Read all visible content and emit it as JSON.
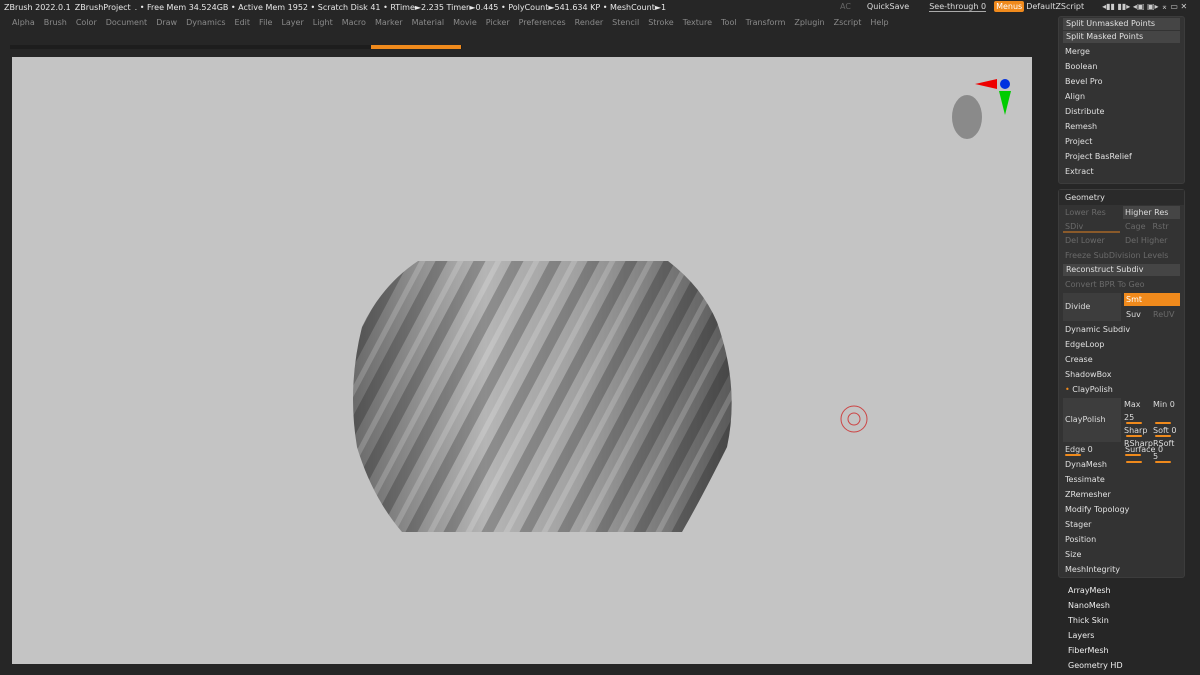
{
  "title": {
    "app": "ZBrush 2022.0.1",
    "project": "ZBrushProject",
    "stats": ". • Free Mem 34.524GB • Active Mem 1952 • Scratch Disk 41 •  RTime►2.235 Timer►0.445 • PolyCount►541.634 KP  • MeshCount►1"
  },
  "topright": {
    "ac": "AC",
    "quicksave": "QuickSave",
    "seethrough": "See-through",
    "seethrough_value": "0",
    "menus": "Menus",
    "script": "DefaultZScript"
  },
  "menu": [
    "Alpha",
    "Brush",
    "Color",
    "Document",
    "Draw",
    "Dynamics",
    "Edit",
    "File",
    "Layer",
    "Light",
    "Macro",
    "Marker",
    "Material",
    "Movie",
    "Picker",
    "Preferences",
    "Render",
    "Stencil",
    "Stroke",
    "Texture",
    "Tool",
    "Transform",
    "Zplugin",
    "Zscript",
    "Help"
  ],
  "panel1": {
    "buttons": [
      "Split Unmasked Points",
      "Split Masked Points"
    ],
    "items": [
      "Merge",
      "Boolean",
      "Bevel Pro",
      "Align",
      "Distribute",
      "Remesh",
      "Project",
      "Project BasRelief",
      "Extract"
    ]
  },
  "geometry": {
    "title": "Geometry",
    "lower_res": "Lower Res",
    "higher_res": "Higher Res",
    "sdiv": "SDiv",
    "cage": "Cage",
    "rstr": "Rstr",
    "del_lower": "Del Lower",
    "del_higher": "Del Higher",
    "freeze": "Freeze SubDivision Levels",
    "reconstruct": "Reconstruct Subdiv",
    "convert_bpr": "Convert BPR To Geo",
    "divide": "Divide",
    "smt": "Smt",
    "suv": "Suv",
    "reluv": "ReUV",
    "items": [
      "Dynamic Subdiv",
      "EdgeLoop",
      "Crease",
      "ShadowBox"
    ],
    "claypolish_header": "ClayPolish",
    "claypolish": "ClayPolish",
    "max": "Max 25",
    "min": "Min 0",
    "sharp": "Sharp",
    "soft": "Soft 0",
    "rsharp": "RSharp",
    "rsoft": "RSoft 5",
    "edge": "Edge 0",
    "surface": "Surface 0",
    "items2": [
      "DynaMesh",
      "Tessimate",
      "ZRemesher",
      "Modify Topology",
      "Stager",
      "Position",
      "Size",
      "MeshIntegrity"
    ]
  },
  "subpalettes": [
    "ArrayMesh",
    "NanoMesh",
    "Thick Skin",
    "Layers",
    "FiberMesh",
    "Geometry HD"
  ],
  "colors": {
    "accent": "#f08a1c",
    "canvas": "#c4c4c4"
  }
}
